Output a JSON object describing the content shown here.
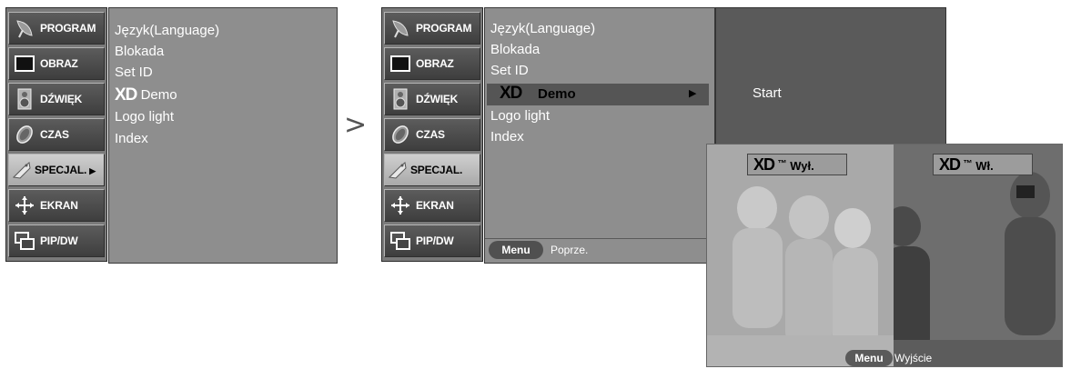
{
  "sidebar": {
    "items": [
      {
        "label": "PROGRAM",
        "icon": "satellite-dish-icon"
      },
      {
        "label": "OBRAZ",
        "icon": "screen-icon"
      },
      {
        "label": "DŹWIĘK",
        "icon": "speaker-icon"
      },
      {
        "label": "CZAS",
        "icon": "clock-icon"
      },
      {
        "label": "SPECJAL.",
        "icon": "tag-icon"
      },
      {
        "label": "EKRAN",
        "icon": "move-arrows-icon"
      },
      {
        "label": "PIP/DW",
        "icon": "pip-icon"
      }
    ],
    "active_marker": "▶"
  },
  "menu": {
    "items": [
      "Język(Language)",
      "Blokada",
      "Set ID",
      "Demo",
      "Logo light",
      "Index"
    ],
    "xd_logo": "XD",
    "submenu_arrow": "▶"
  },
  "separator_glyph": ">",
  "footer": {
    "menu_label": "Menu",
    "back_label": "Poprze."
  },
  "submenu": {
    "start_label": "Start"
  },
  "demo": {
    "left_label": "Wył.",
    "right_label": "Wł.",
    "tm": "™",
    "menu_label": "Menu",
    "exit_label": "Wyjście"
  }
}
